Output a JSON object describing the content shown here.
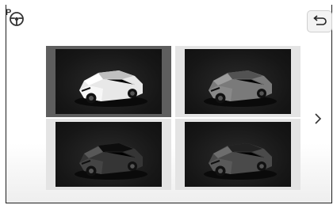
{
  "header": {
    "assist_icon": "parking-assist-steering-icon",
    "back_icon": "return-arrow-icon"
  },
  "navigation": {
    "next_icon": "chevron-right-icon"
  },
  "car_options": [
    {
      "body_color": "#e8e8e8",
      "selected": true
    },
    {
      "body_color": "#7a7a7a",
      "selected": false
    },
    {
      "body_color": "#353535",
      "selected": false
    },
    {
      "body_color": "#4a4a4a",
      "selected": false
    }
  ],
  "colors": {
    "selected_tile_bg": "#5e5e5e",
    "tile_bg": "#e4e4e4",
    "image_bg": "#161616"
  }
}
